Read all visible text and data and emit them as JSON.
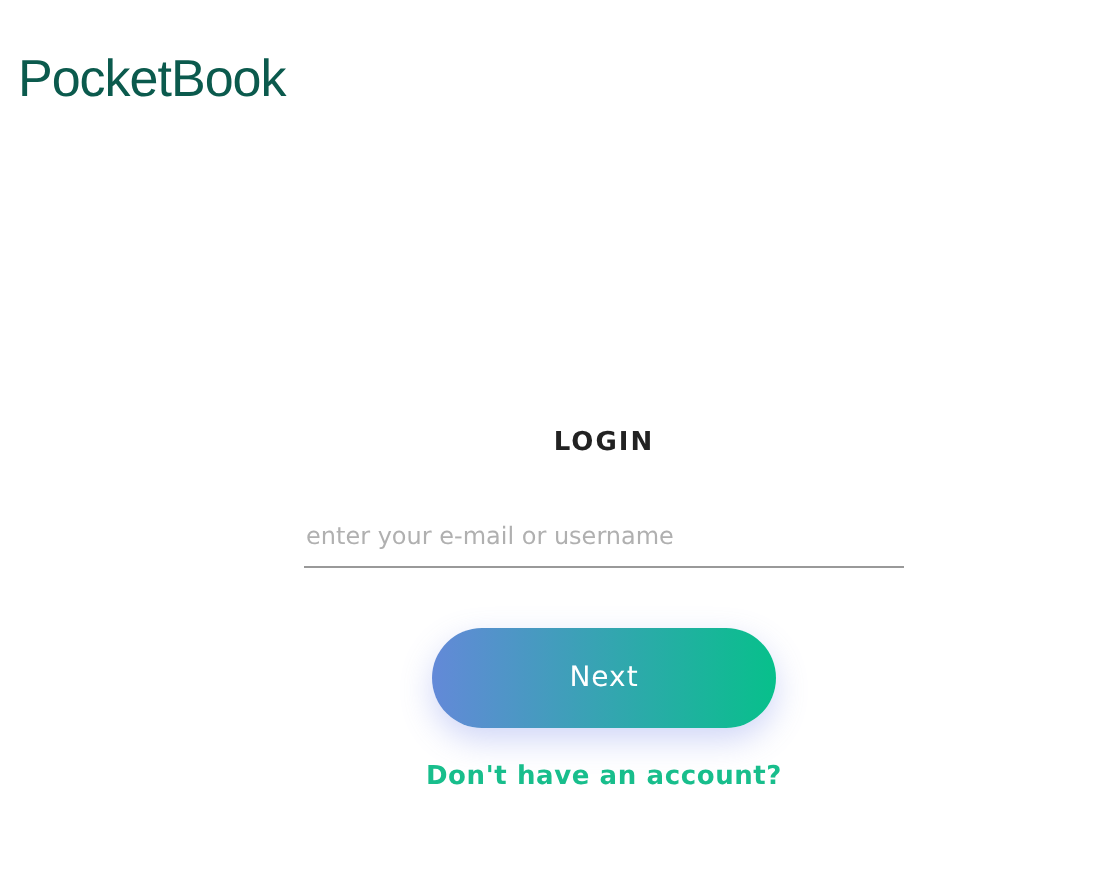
{
  "logo": {
    "text": "PocketBook"
  },
  "login": {
    "title": "LOGIN",
    "email": {
      "placeholder": "enter your e-mail or username"
    },
    "next_button": "Next",
    "signup_link": "Don't have an account?"
  }
}
